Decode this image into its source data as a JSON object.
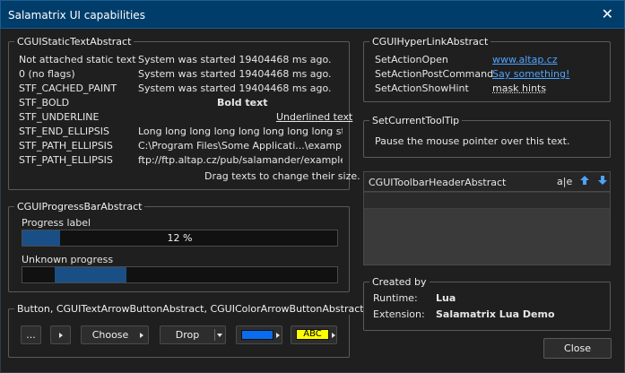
{
  "window": {
    "title": "Salamatrix UI capabilities"
  },
  "static_text": {
    "legend": "CGUIStaticTextAbstract",
    "rows": [
      {
        "label": "Not attached static text",
        "value": "System was started 19404468 ms ago."
      },
      {
        "label": "0 (no flags)",
        "value": "System was started 19404468 ms ago."
      },
      {
        "label": "STF_CACHED_PAINT",
        "value": "System was started 19404468 ms ago."
      },
      {
        "label": "STF_BOLD",
        "value": "Bold text"
      },
      {
        "label": "STF_UNDERLINE",
        "value": "Underlined text"
      },
      {
        "label": "STF_END_ELLIPSIS",
        "value": "Long long long long long long long long st..."
      },
      {
        "label": "STF_PATH_ELLIPSIS",
        "value": "C:\\Program Files\\Some Applicati...\\example.exe"
      },
      {
        "label": "STF_PATH_ELLIPSIS",
        "value": "ftp://ftp.altap.cz/pub/salamander/example.exe"
      }
    ],
    "hint": "Drag texts to change their size."
  },
  "progress": {
    "legend": "CGUIProgressBarAbstract",
    "label1": "Progress label",
    "percent": 12,
    "percent_text": "12 %",
    "label2": "Unknown progress"
  },
  "buttons": {
    "legend": "Button, CGUITextArrowButtonAbstract, CGUIColorArrowButtonAbstract",
    "dots": "...",
    "choose": "Choose",
    "drop": "Drop",
    "abc": "ABC",
    "colors": {
      "blue_swatch": "#0a6cf0",
      "yellow_swatch": "#ffff00"
    }
  },
  "hyperlink": {
    "legend": "CGUIHyperLinkAbstract",
    "rows": [
      {
        "label": "SetActionOpen",
        "value": "www.altap.cz"
      },
      {
        "label": "SetActionPostCommand",
        "value": "Say something!"
      },
      {
        "label": "SetActionShowHint",
        "value": "mask hints"
      }
    ]
  },
  "tooltip": {
    "legend": "SetCurrentToolTip",
    "text": "Pause the mouse pointer over this text."
  },
  "toolbar_header": {
    "title": "CGUIToolbarHeaderAbstract"
  },
  "created_by": {
    "legend": "Created by",
    "runtime_label": "Runtime:",
    "runtime_value": "Lua",
    "extension_label": "Extension:",
    "extension_value": "Salamatrix Lua Demo"
  },
  "close_button": "Close"
}
